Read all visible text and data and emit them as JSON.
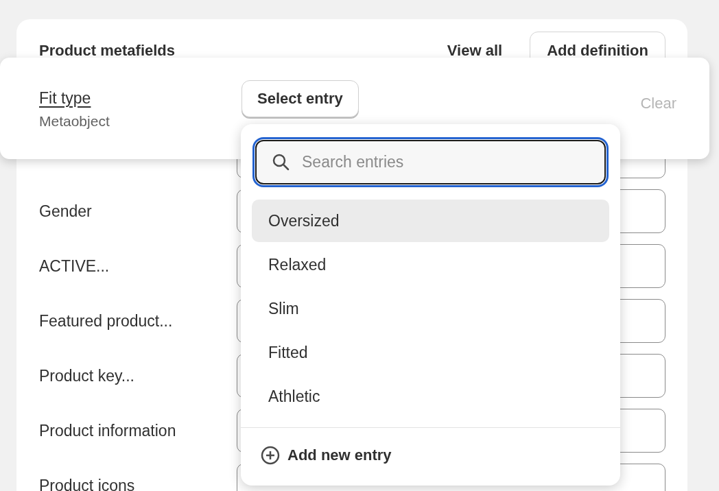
{
  "card": {
    "title": "Product metafields",
    "link": "View all",
    "button": "Add definition",
    "rows": [
      {},
      {
        "label": "Gender"
      },
      {
        "label": "ACTIVE..."
      },
      {
        "label": "Featured product..."
      },
      {
        "label": "Product key..."
      },
      {
        "label": "Product information"
      },
      {
        "label": "Product icons"
      }
    ]
  },
  "editor": {
    "name": "Fit type",
    "type": "Metaobject",
    "select_button": "Select entry",
    "clear": "Clear"
  },
  "dropdown": {
    "search": {
      "placeholder": "Search entries"
    },
    "options": [
      {
        "label": "Oversized",
        "selected": true
      },
      {
        "label": "Relaxed",
        "selected": false
      },
      {
        "label": "Slim",
        "selected": false
      },
      {
        "label": "Fitted",
        "selected": false
      },
      {
        "label": "Athletic",
        "selected": false
      }
    ],
    "add": "Add new entry"
  }
}
